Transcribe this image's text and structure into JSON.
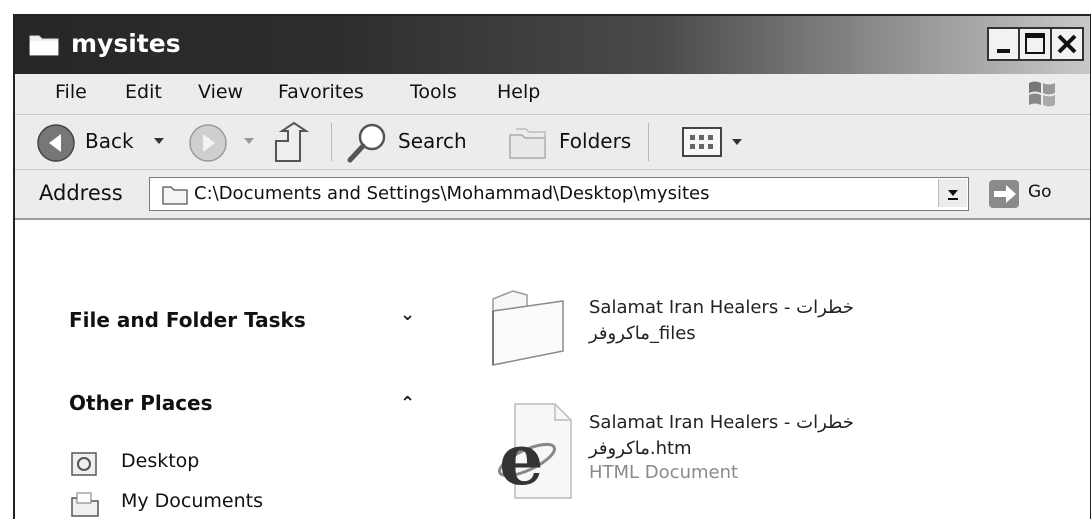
{
  "window": {
    "title": "mysites",
    "controls": {
      "minimize": "_",
      "maximize": "□",
      "close": "×"
    }
  },
  "menu": {
    "items": [
      "File",
      "Edit",
      "View",
      "Favorites",
      "Tools",
      "Help"
    ]
  },
  "toolbar": {
    "back_label": "Back",
    "search_label": "Search",
    "folders_label": "Folders"
  },
  "address": {
    "label": "Address",
    "value": "C:\\Documents and Settings\\Mohammad\\Desktop\\mysites",
    "go_label": "Go"
  },
  "tasks": {
    "file_folder_tasks": "File and Folder Tasks",
    "other_places": "Other Places",
    "places": [
      "Desktop",
      "My Documents"
    ]
  },
  "files": [
    {
      "line1": "Salamat Iran Healers - خطرات",
      "line2": "ماکروفر_files",
      "icon": "folder-icon"
    },
    {
      "line1": "Salamat Iran Healers - خطرات",
      "line2": "ماکروفر.htm",
      "line3": "HTML Document",
      "icon": "ie-document-icon"
    }
  ]
}
